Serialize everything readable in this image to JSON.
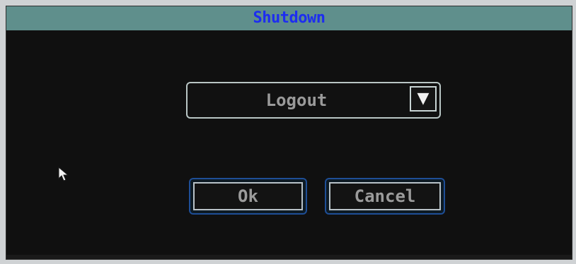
{
  "window": {
    "title": "Shutdown"
  },
  "shutdown_dialog": {
    "mode_select": {
      "selected_value": "Logout",
      "dropdown_icon": "triangle-down-icon"
    },
    "buttons": {
      "ok_label": "Ok",
      "cancel_label": "Cancel"
    },
    "pointer_icon": "mouse-pointer-icon"
  },
  "colors": {
    "title_bar_bg": "#5f8f8c",
    "title_text": "#1d2df0",
    "dialog_bg": "#101010",
    "label_text": "#9a9a9a",
    "button_outer_border": "#1e4e96",
    "control_border": "#b9c6c5"
  }
}
